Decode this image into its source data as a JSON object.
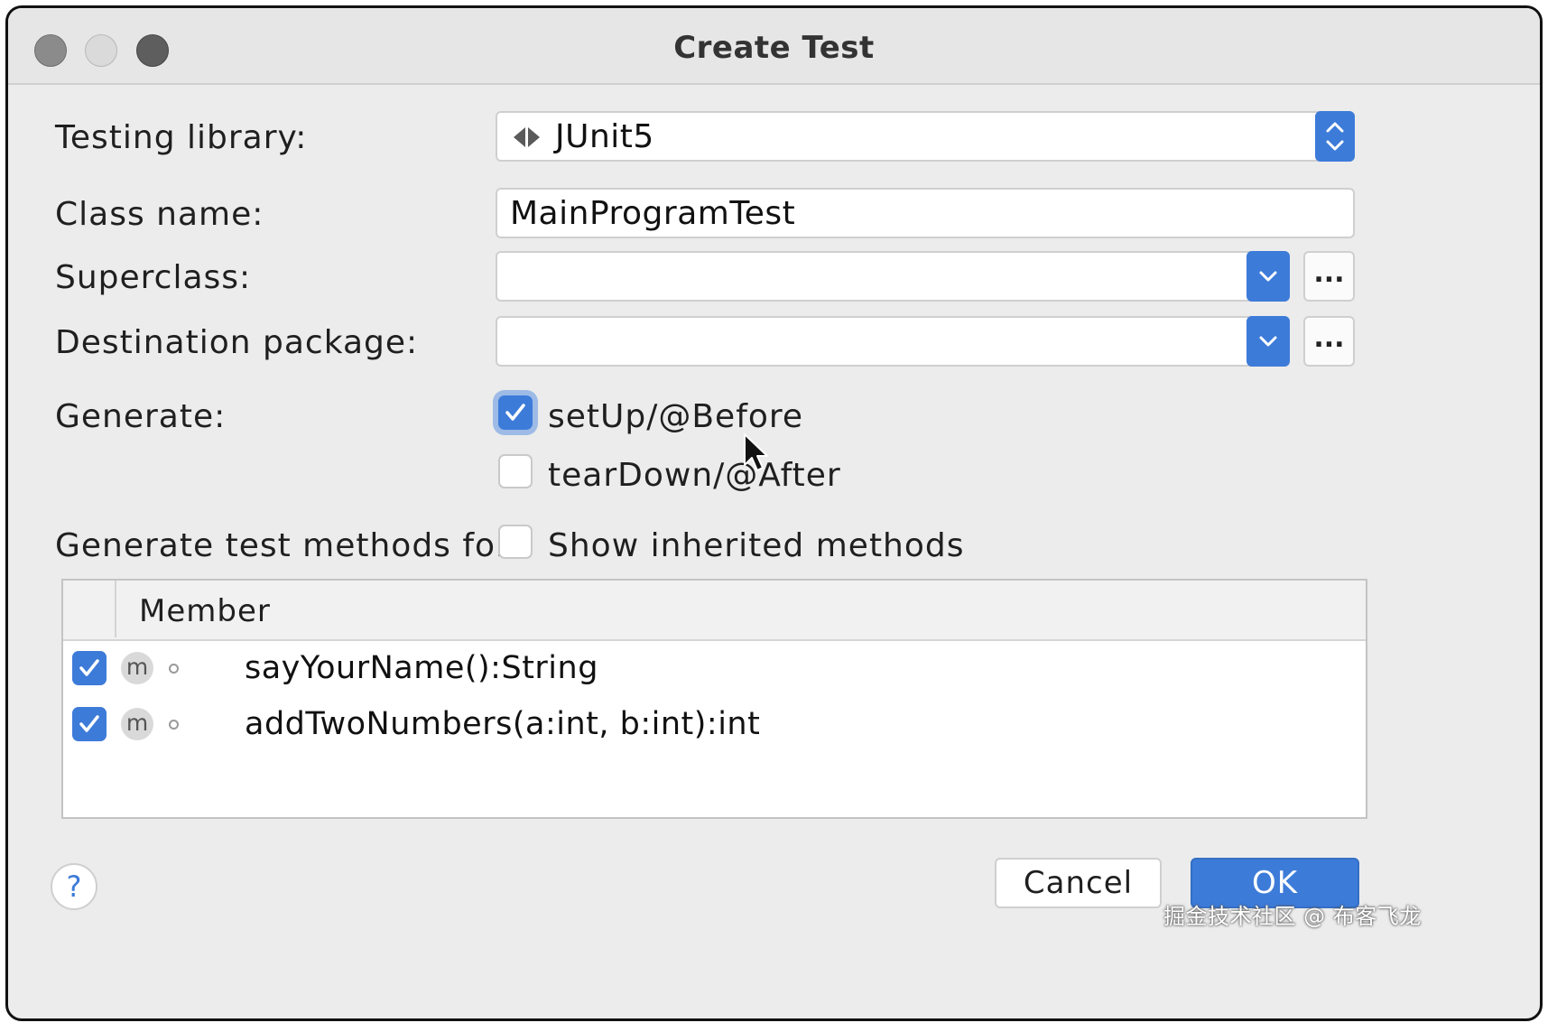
{
  "window": {
    "title": "Create Test"
  },
  "form": {
    "testing_library": {
      "label": "Testing library:",
      "value": "JUnit5"
    },
    "class_name": {
      "label": "Class name:",
      "value": "MainProgramTest"
    },
    "superclass": {
      "label": "Superclass:",
      "value": "",
      "browse_label": "..."
    },
    "destination_package": {
      "label": "Destination package:",
      "value": "",
      "browse_label": "..."
    },
    "generate": {
      "label": "Generate:",
      "options": [
        {
          "label": "setUp/@Before",
          "checked": true
        },
        {
          "label": "tearDown/@After",
          "checked": false
        }
      ]
    },
    "generate_methods": {
      "label": "Generate test methods for:",
      "show_inherited": {
        "label": "Show inherited methods",
        "checked": false
      }
    }
  },
  "members_table": {
    "header": "Member",
    "rows": [
      {
        "checked": true,
        "icon": "m",
        "signature": "sayYourName():String"
      },
      {
        "checked": true,
        "icon": "m",
        "signature": "addTwoNumbers(a:int, b:int):int"
      }
    ]
  },
  "footer": {
    "help_label": "?",
    "cancel_label": "Cancel",
    "ok_label": "OK"
  },
  "watermark": "掘金技术社区 @ 布客飞龙",
  "colors": {
    "accent": "#3d7bd9",
    "background": "#ececec"
  }
}
